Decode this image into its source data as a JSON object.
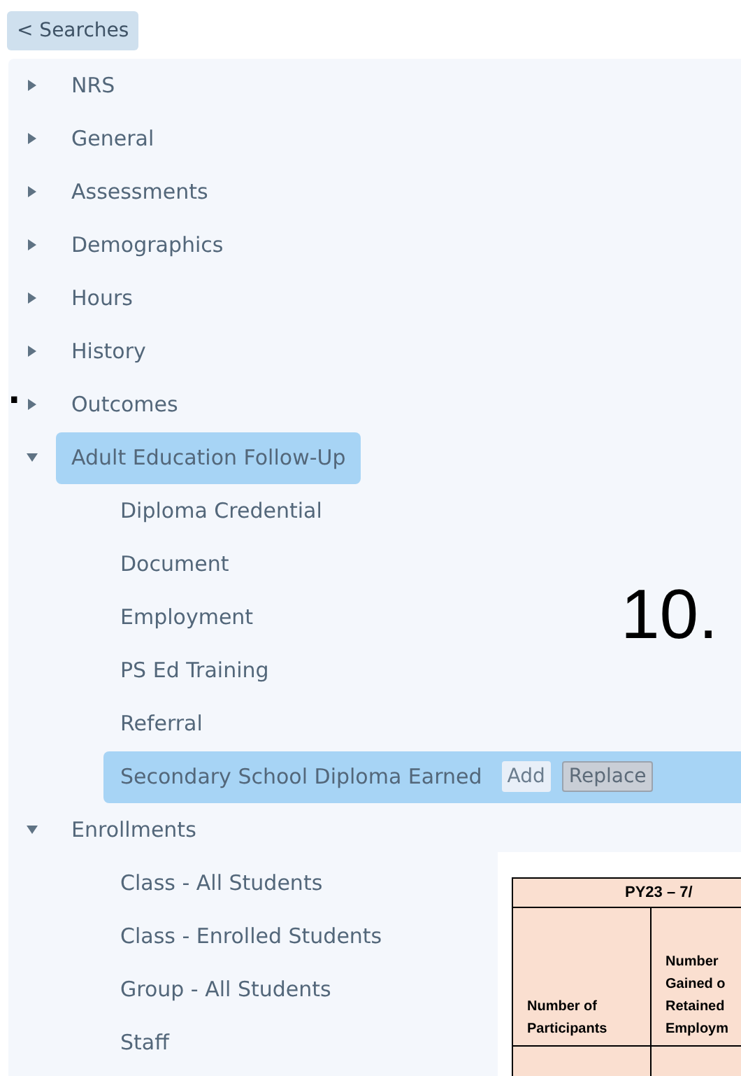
{
  "back_button": {
    "label": "< Searches"
  },
  "tree": [
    {
      "label": "NRS",
      "expanded": false,
      "selected": false
    },
    {
      "label": "General",
      "expanded": false,
      "selected": false
    },
    {
      "label": "Assessments",
      "expanded": false,
      "selected": false
    },
    {
      "label": "Demographics",
      "expanded": false,
      "selected": false
    },
    {
      "label": "Hours",
      "expanded": false,
      "selected": false
    },
    {
      "label": "History",
      "expanded": false,
      "selected": false
    },
    {
      "label": "Outcomes",
      "expanded": false,
      "selected": false
    },
    {
      "label": "Adult Education Follow-Up",
      "expanded": true,
      "selected": true,
      "children": [
        {
          "label": "Diploma Credential",
          "selected": false
        },
        {
          "label": "Document",
          "selected": false
        },
        {
          "label": "Employment",
          "selected": false
        },
        {
          "label": "PS Ed Training",
          "selected": false
        },
        {
          "label": "Referral",
          "selected": false
        },
        {
          "label": "Secondary School Diploma Earned",
          "selected": true,
          "actions": [
            {
              "label": "Add",
              "kind": "add"
            },
            {
              "label": "Replace",
              "kind": "replace"
            }
          ]
        }
      ]
    },
    {
      "label": "Enrollments",
      "expanded": true,
      "selected": false,
      "children": [
        {
          "label": "Class - All Students",
          "selected": false
        },
        {
          "label": "Class - Enrolled Students",
          "selected": false
        },
        {
          "label": "Group - All Students",
          "selected": false
        },
        {
          "label": "Staff",
          "selected": false
        }
      ]
    }
  ],
  "annotations": [
    {
      "text": ".",
      "kind": "left"
    },
    {
      "text": "10.",
      "kind": "right"
    }
  ],
  "table": {
    "title": "PY23 – 7/",
    "columns": [
      "Number of\nParticipants",
      "Number\nGained o\nRetained\nEmploym"
    ]
  }
}
